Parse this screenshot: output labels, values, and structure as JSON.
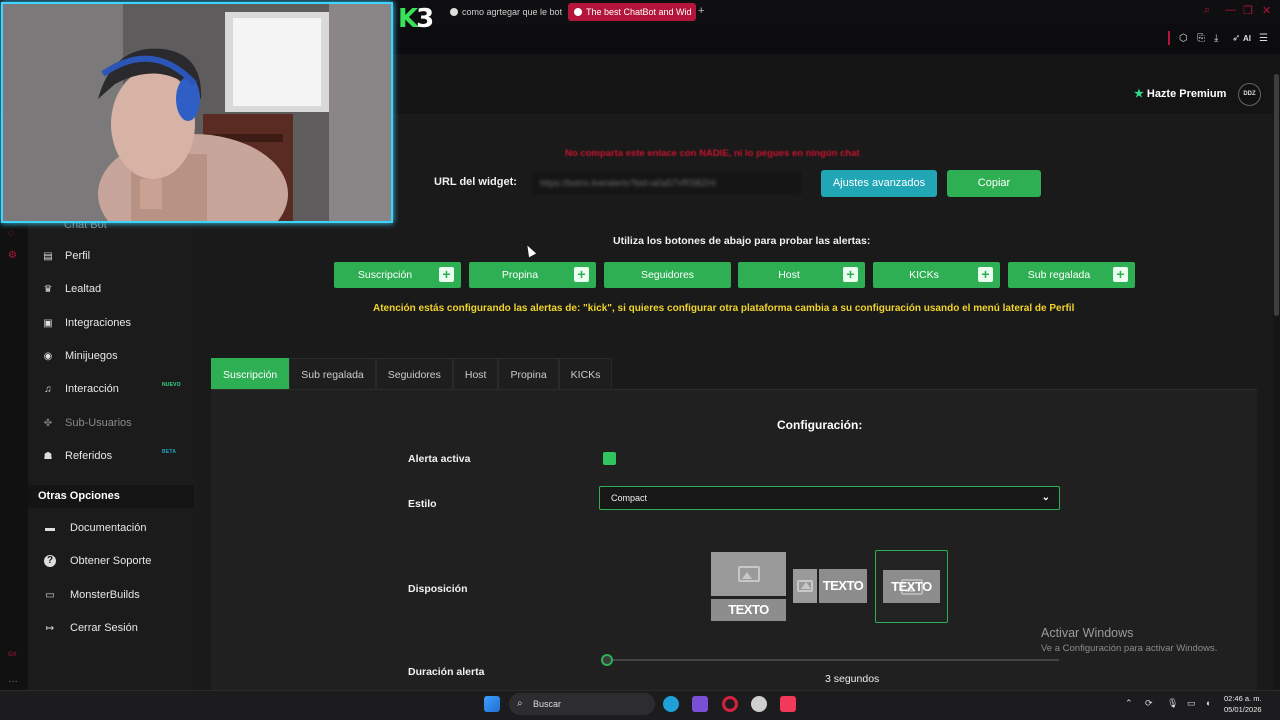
{
  "browser": {
    "tabs": [
      {
        "label": "como agrtegar que le bot"
      },
      {
        "label": "The best ChatBot and Wid"
      }
    ],
    "new_tab": "+",
    "toolbar_ai": "AI"
  },
  "overlay": {
    "logo_letter": "K",
    "logo_number": "3"
  },
  "header": {
    "premium_label": "Hazte Premium",
    "avatar_text": "DDZ"
  },
  "sidebar": {
    "ghost_item": "Chat Bot",
    "items": [
      {
        "label": "Perfil",
        "icon": "id-card-icon",
        "glyph": "▤"
      },
      {
        "label": "Lealtad",
        "icon": "trophy-icon",
        "glyph": "🏆"
      },
      {
        "label": "Integraciones",
        "icon": "monitor-icon",
        "glyph": "▣"
      },
      {
        "label": "Minijuegos",
        "icon": "gamepad-icon",
        "glyph": "◉"
      },
      {
        "label": "Interacción",
        "icon": "music-icon",
        "glyph": "♫",
        "badge": "NUEVO"
      },
      {
        "label": "Sub-Usuarios",
        "icon": "users-icon",
        "glyph": "✤"
      },
      {
        "label": "Referidos",
        "icon": "user-group-icon",
        "glyph": "👥",
        "badge": "BETA"
      }
    ],
    "otras_title": "Otras Opciones",
    "other_items": [
      {
        "label": "Documentación",
        "icon": "book-icon",
        "glyph": "▬"
      },
      {
        "label": "Obtener Soporte",
        "icon": "help-icon",
        "glyph": "?"
      },
      {
        "label": "MonsterBuilds",
        "icon": "laptop-icon",
        "glyph": "▭"
      },
      {
        "label": "Cerrar Sesión",
        "icon": "logout-icon",
        "glyph": "↦"
      }
    ],
    "badge_colors": {
      "nuevo": "#31d98a",
      "beta": "#1fa8c0"
    }
  },
  "widget": {
    "warning": "No comparta este enlace con NADIE, ni lo pegues en ningún chat",
    "url_label": "URL del widget:",
    "url_value": "https://botrix.live/alerts?bid=a0a57VRSBZHI",
    "advanced_button": "Ajustes avanzados",
    "copy_button": "Copiar"
  },
  "test": {
    "instruction": "Utiliza los botones de abajo para probar las alertas:",
    "buttons": [
      {
        "label": "Suscripción",
        "plus": true
      },
      {
        "label": "Propina",
        "plus": true
      },
      {
        "label": "Seguidores",
        "plus": false
      },
      {
        "label": "Host",
        "plus": true
      },
      {
        "label": "KICKs",
        "plus": true
      },
      {
        "label": "Sub regalada",
        "plus": true
      }
    ],
    "attention": "Atención estás configurando las alertas de: \"kick\", si quieres configurar otra plataforma cambia a su configuración usando el menú lateral de Perfil"
  },
  "tabs": [
    {
      "label": "Suscripción",
      "active": true
    },
    {
      "label": "Sub regalada",
      "active": false
    },
    {
      "label": "Seguidores",
      "active": false
    },
    {
      "label": "Host",
      "active": false
    },
    {
      "label": "Propina",
      "active": false
    },
    {
      "label": "KICKs",
      "active": false
    }
  ],
  "config": {
    "title": "Configuración:",
    "alert_active_label": "Alerta activa",
    "alert_active": true,
    "style_label": "Estilo",
    "style_value": "Compact",
    "layout_label": "Disposición",
    "layout_text": "TEXTO",
    "selected_layout": 3,
    "duration_label": "Duración alerta",
    "duration_value": "3 segundos",
    "duration_seconds": 3
  },
  "windows_activation": {
    "title": "Activar Windows",
    "subtitle": "Ve a Configuración para activar Windows."
  },
  "taskbar": {
    "search_placeholder": "Buscar",
    "time": "02:46 a. m.",
    "date": "05/01/2026"
  },
  "colors": {
    "accent_green": "#2eaf53",
    "accent_teal": "#20a6b5",
    "warning_red": "#c4142f",
    "attention_yellow": "#f0d32b",
    "opera_red": "#b3163a",
    "webcam_border": "#3fd4ff"
  }
}
